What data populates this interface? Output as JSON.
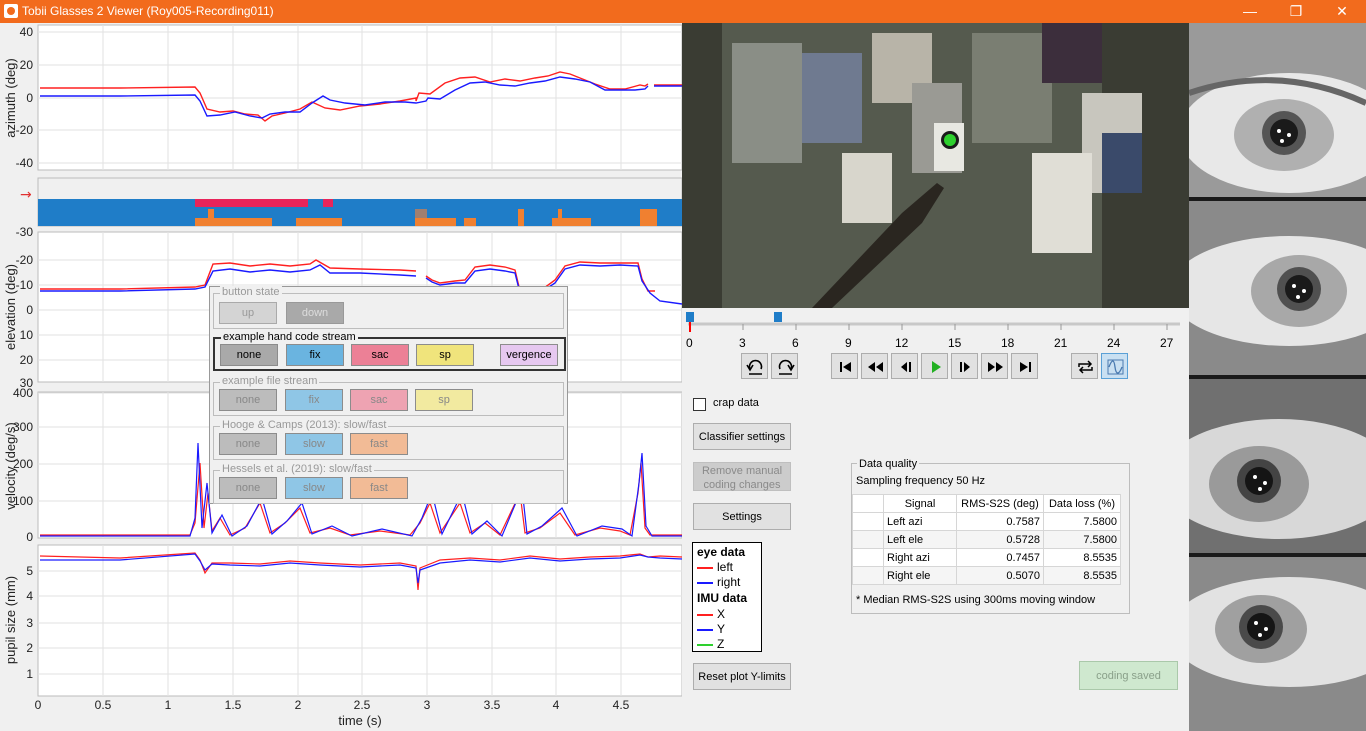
{
  "window": {
    "title": "Tobii Glasses 2 Viewer (Roy005-Recording011)",
    "minimize_icon": "minimize-icon",
    "restore_icon": "restore-icon",
    "close_icon": "close-icon"
  },
  "plots": {
    "xlabel": "time (s)",
    "xticks": [
      "0",
      "0.5",
      "1",
      "1.5",
      "2",
      "2.5",
      "3",
      "3.5",
      "4",
      "4.5"
    ],
    "azimuth": {
      "ylabel": "azimuth (deg)",
      "yticks": [
        "40",
        "20",
        "0",
        "-20",
        "-40"
      ]
    },
    "elevation": {
      "ylabel": "elevation (deg)",
      "yticks": [
        "-30",
        "-20",
        "-10",
        "0",
        "10",
        "20",
        "30"
      ]
    },
    "velocity": {
      "ylabel": "velocity (deg/s)",
      "yticks": [
        "400",
        "300",
        "200",
        "100",
        "0"
      ]
    },
    "pupil": {
      "ylabel": "pupil size (mm)",
      "yticks": [
        "5",
        "4",
        "3",
        "2",
        "1"
      ]
    },
    "colors": {
      "left": "#ff2020",
      "right": "#1a1aff",
      "fix": "#1f7dc8",
      "sac": "#e8245a",
      "slow_fast": "#f08030"
    }
  },
  "code_panel": {
    "button_state": {
      "title": "button state",
      "up": "up",
      "down": "down"
    },
    "hand_code": {
      "title": "example hand code stream",
      "none": "none",
      "fix": "fix",
      "sac": "sac",
      "sp": "sp",
      "vergence": "vergence"
    },
    "file_stream": {
      "title": "example file stream",
      "none": "none",
      "fix": "fix",
      "sac": "sac",
      "sp": "sp"
    },
    "hooge": {
      "title": "Hooge & Camps (2013): slow/fast",
      "none": "none",
      "slow": "slow",
      "fast": "fast"
    },
    "hessels": {
      "title": "Hessels et al. (2019): slow/fast",
      "none": "none",
      "slow": "slow",
      "fast": "fast"
    }
  },
  "timeline": {
    "ticks": [
      "0",
      "3",
      "6",
      "9",
      "12",
      "15",
      "18",
      "21",
      "24",
      "27"
    ]
  },
  "controls": {
    "crap_data": "crap data",
    "classifier_settings": "Classifier settings",
    "remove_manual": "Remove manual coding changes",
    "settings": "Settings",
    "reset_plot": "Reset plot Y-limits",
    "coding_saved": "coding saved"
  },
  "legend": {
    "eye_data": "eye data",
    "left": "left",
    "right": "right",
    "imu_data": "IMU data",
    "x": "X",
    "y": "Y",
    "z": "Z"
  },
  "data_quality": {
    "title": "Data quality",
    "sampling": "Sampling frequency 50 Hz",
    "headers": [
      "Signal",
      "RMS-S2S (deg)",
      "Data loss (%)"
    ],
    "rows": [
      {
        "signal": "Left azi",
        "rms": "0.7587",
        "loss": "7.5800"
      },
      {
        "signal": "Left ele",
        "rms": "0.5728",
        "loss": "7.5800"
      },
      {
        "signal": "Right azi",
        "rms": "0.7457",
        "loss": "8.5535"
      },
      {
        "signal": "Right ele",
        "rms": "0.5070",
        "loss": "8.5535"
      }
    ],
    "note": "* Median RMS-S2S using 300ms moving window"
  }
}
